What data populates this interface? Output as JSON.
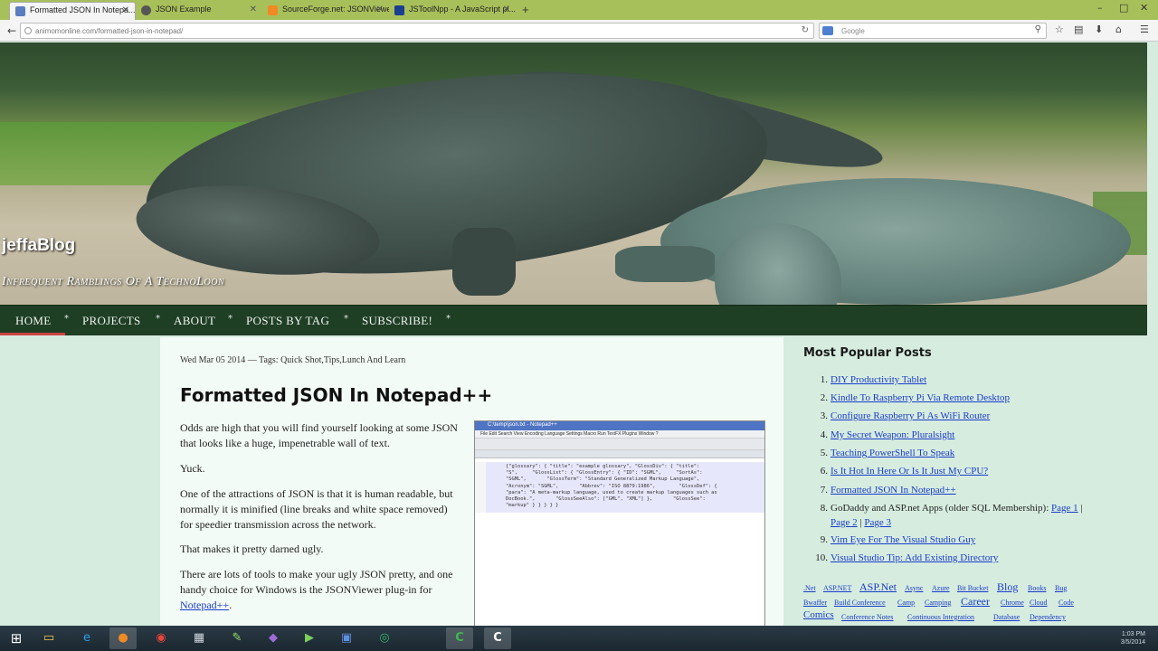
{
  "browser": {
    "tabs": [
      {
        "label": "Formatted JSON In Notepa...",
        "active": true,
        "favicon_color": "#5a7dbf"
      },
      {
        "label": "JSON Example",
        "active": false,
        "favicon_color": "#555555"
      },
      {
        "label": "SourceForge.net: JSONViewer ...",
        "active": false,
        "favicon_color": "#f08a24"
      },
      {
        "label": "JSToolNpp - A JavaScript pl...",
        "active": false,
        "favicon_color": "#1b3f8f"
      }
    ],
    "url": "animomonline.com/formatted-json-in-notepad/",
    "search_placeholder": "Google",
    "search_engine_icon": "google-icon"
  },
  "blog": {
    "title": "jeffaBlog",
    "tagline": "Infrequent Ramblings Of A TechnoLoon",
    "nav": [
      "HOME",
      "PROJECTS",
      "ABOUT",
      "POSTS BY TAG",
      "SUBSCRIBE!"
    ],
    "nav_separator": "*"
  },
  "post": {
    "meta": "Wed Mar 05 2014 — Tags: Quick Shot,Tips,Lunch And Learn",
    "title": "Formatted JSON In Notepad++",
    "paragraphs": [
      "Odds are high that you will find yourself looking at some JSON that looks like a huge, impenetrable wall of text.",
      "Yuck.",
      "One of the attractions of JSON is that it is human readable, but normally it is minified (line breaks and white space removed) for speedier transmission across the network.",
      "That makes it pretty darned ugly."
    ],
    "tools_para_prefix": "There are lots of tools to make your ugly JSON pretty, and one handy choice for Windows is the JSONViewer plug-in for ",
    "tools_para_link": "Notepad++",
    "tools_para_suffix": "."
  },
  "screenshot": {
    "window_title": "C:\\temp\\json.txt - Notepad++",
    "menu": "File  Edit  Search  View  Encoding  Language  Settings  Macro  Run  TextFX  Plugins  Window  ?",
    "code": "{\"glossary\": { \"title\": \"example glossary\", \"GlossDiv\": { \"title\":\n\"S\",     \"GlossList\": { \"GlossEntry\": { \"ID\": \"SGML\",     \"SortAs\":\n\"SGML\",       \"GlossTerm\": \"Standard Generalized Markup Language\",\n\"Acronym\": \"SGML\",       \"Abbrev\": \"ISO 8879:1986\",        \"GlossDef\": {\n\"para\": \"A meta-markup language, used to create markup languages such as\nDocBook.\",       \"GlossSeeAlso\": [\"GML\", \"XML\"] },       \"GlossSee\":\n\"markup\" } } } } }"
  },
  "sidebar": {
    "heading": "Most Popular Posts",
    "popular": [
      {
        "num": "1.",
        "text": "DIY Productivity Tablet"
      },
      {
        "num": "2.",
        "text": "Kindle To Raspberry Pi Via Remote Desktop"
      },
      {
        "num": "3.",
        "text": "Configure Raspberry Pi As WiFi Router"
      },
      {
        "num": "4.",
        "text": "My Secret Weapon: Pluralsight"
      },
      {
        "num": "5.",
        "text": "Teaching PowerShell To Speak"
      },
      {
        "num": "6.",
        "text": "Is It Hot In Here Or Is It Just My CPU?"
      },
      {
        "num": "7.",
        "text": "Formatted JSON In Notepad++"
      },
      {
        "num": "8.",
        "text": "GoDaddy and ASP.net Apps (older SQL Membership):",
        "link1": "Page 1",
        "link2": "Page 2",
        "link3": "Page 3"
      },
      {
        "num": "9.",
        "text": "Vim Eye For The Visual Studio Guy"
      },
      {
        "num": "10.",
        "text": "Visual Studio Tip: Add Existing Directory"
      }
    ],
    "tags": [
      ".Net",
      "ASP.NET",
      "ASP.Net",
      "Async",
      "Azure",
      "Bit Bucket",
      "Blog",
      "Books",
      "Bug",
      "Bwaffer",
      "Build Conference",
      "Camp",
      "Camping",
      "Career",
      "Chrome",
      "Cloud",
      "Code",
      "Comics",
      "Conference Notes",
      "Continuous Integration",
      "Database",
      "Dependency"
    ]
  },
  "taskbar": {
    "apps": [
      "start-icon",
      "file-explorer-icon",
      "internet-explorer-icon",
      "firefox-icon",
      "chrome-icon",
      "calculator-icon",
      "notepad-icon",
      "visual-studio-icon",
      "media-player-icon",
      "remote-desktop-icon",
      "camtasia-icon",
      "camtasia-recorder-icon"
    ],
    "time": "1:03 PM",
    "date": "3/5/2014"
  }
}
